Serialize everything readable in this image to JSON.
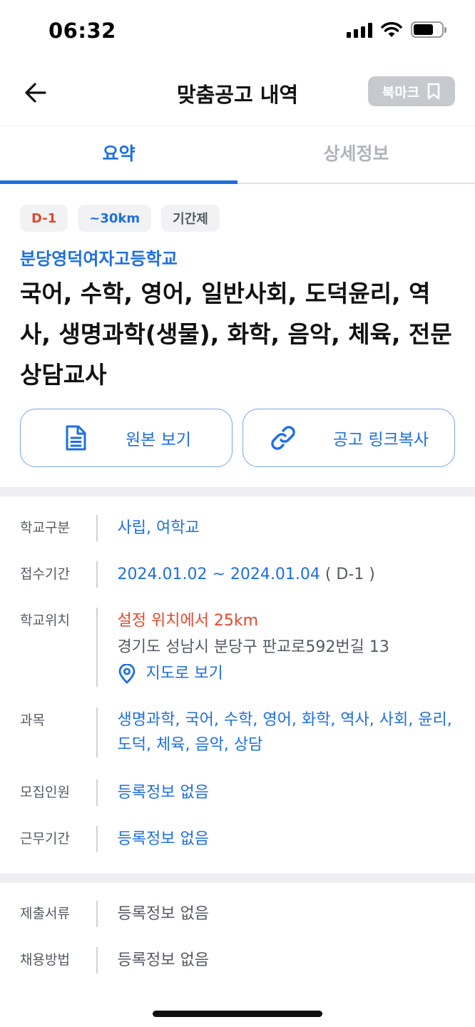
{
  "status_bar": {
    "time": "06:32"
  },
  "header": {
    "title": "맞춤공고 내역",
    "bookmark_label": "북마크"
  },
  "tabs": [
    {
      "label": "요약",
      "active": true
    },
    {
      "label": "상세정보",
      "active": false
    }
  ],
  "summary": {
    "chips": [
      "D-1",
      "~30km",
      "기간제"
    ],
    "school_name": "분당영덕여자고등학교",
    "job_title": "국어, 수학, 영어, 일반사회, 도덕윤리, 역사, 생명과학(생물), 화학, 음악, 체육, 전문상담교사",
    "view_original_label": "원본 보기",
    "copy_link_label": "공고 링크복사"
  },
  "details": {
    "school_type": {
      "label": "학교구분",
      "value": "사립, 여학교"
    },
    "application_period": {
      "label": "접수기간",
      "value": "2024.01.02 ~ 2024.01.04",
      "dday": "( D-1 )"
    },
    "location": {
      "label": "학교위치",
      "distance": "설정 위치에서 25km",
      "address": "경기도 성남시 분당구 판교로592번길 13",
      "map_label": "지도로 보기"
    },
    "subjects": {
      "label": "과목",
      "value": "생명과학, 국어, 수학, 영어, 화학, 역사, 사회, 윤리, 도덕, 체육, 음악, 상담"
    },
    "recruit_count": {
      "label": "모집인원",
      "value": "등록정보 없음"
    },
    "work_period": {
      "label": "근무기간",
      "value": "등록정보 없음"
    }
  },
  "extra": {
    "documents": {
      "label": "제출서류",
      "value": "등록정보 없음"
    },
    "hiring_method": {
      "label": "채용방법",
      "value": "등록정보 없음"
    }
  },
  "colors": {
    "primary": "#1f6fe0",
    "danger": "#e0482e",
    "bookmark_bg": "#c6c9cd"
  }
}
